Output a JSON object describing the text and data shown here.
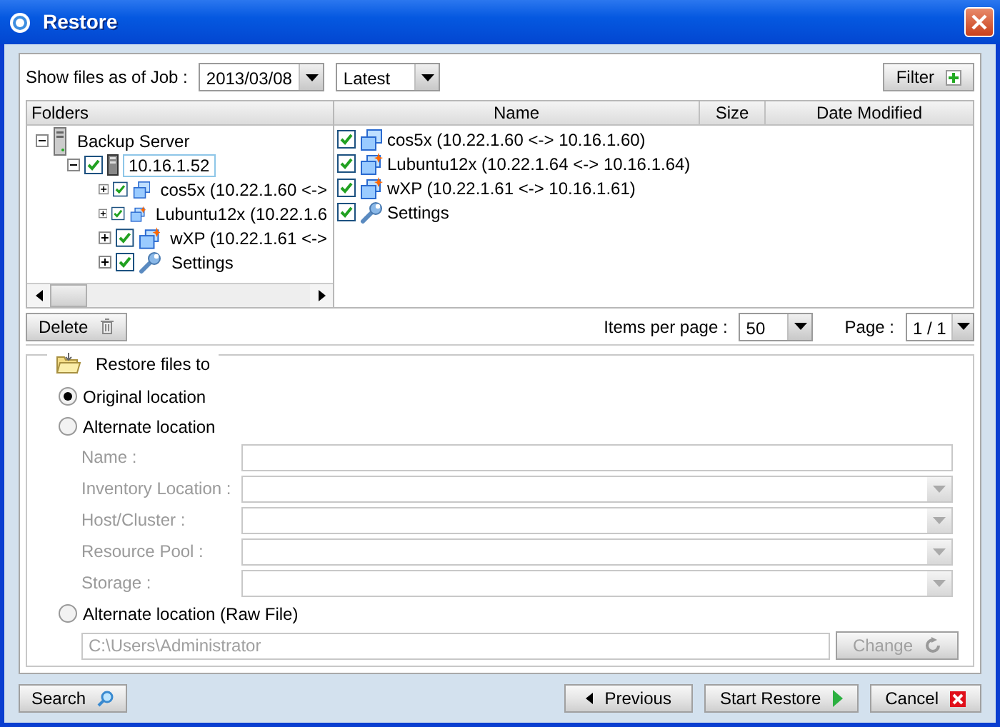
{
  "window": {
    "title": "Restore"
  },
  "job_bar": {
    "label": "Show files as of Job :",
    "date": "2013/03/08",
    "version": "Latest",
    "filter_button": "Filter"
  },
  "folders": {
    "header": "Folders",
    "tree": [
      {
        "label": "Backup Server",
        "kind": "server",
        "expanded": true,
        "selected": false,
        "children": [
          {
            "label": "10.16.1.52",
            "kind": "host",
            "checked": true,
            "expanded": true,
            "selected": true,
            "children": [
              {
                "label": "cos5x (10.22.1.60 <->",
                "kind": "vm",
                "checked": true,
                "expanded": false,
                "selected": false
              },
              {
                "label": "Lubuntu12x (10.22.1.6",
                "kind": "vm-star",
                "checked": true,
                "expanded": false,
                "selected": false
              },
              {
                "label": "wXP  (10.22.1.61 <->",
                "kind": "vm-star",
                "checked": true,
                "expanded": false,
                "selected": false
              },
              {
                "label": "Settings",
                "kind": "settings",
                "checked": true,
                "expanded": false,
                "selected": false
              }
            ]
          }
        ]
      }
    ]
  },
  "files": {
    "columns": [
      "Name",
      "Size",
      "Date Modified"
    ],
    "rows": [
      {
        "name": "cos5x (10.22.1.60 <-> 10.16.1.60)",
        "kind": "vm",
        "checked": true
      },
      {
        "name": "Lubuntu12x (10.22.1.64 <-> 10.16.1.64)",
        "kind": "vm-star",
        "checked": true
      },
      {
        "name": "wXP  (10.22.1.61 <-> 10.16.1.61)",
        "kind": "vm-star",
        "checked": true
      },
      {
        "name": "Settings",
        "kind": "settings",
        "checked": true
      }
    ]
  },
  "pager": {
    "delete_button": "Delete",
    "items_label": "Items per page :",
    "items_value": "50",
    "page_label": "Page :",
    "page_value": "1 / 1"
  },
  "restore": {
    "legend": "Restore files to",
    "options": [
      {
        "label": "Original location",
        "selected": true
      },
      {
        "label": "Alternate location",
        "selected": false,
        "fields": [
          {
            "label": "Name :",
            "kind": "text",
            "disabled": true
          },
          {
            "label": "Inventory Location :",
            "kind": "dropdown",
            "disabled": true
          },
          {
            "label": "Host/Cluster :",
            "kind": "dropdown",
            "disabled": true
          },
          {
            "label": "Resource Pool :",
            "kind": "dropdown",
            "disabled": true
          },
          {
            "label": "Storage :",
            "kind": "dropdown",
            "disabled": true
          }
        ]
      },
      {
        "label": "Alternate location (Raw File)",
        "selected": false,
        "path": {
          "value": "C:\\Users\\Administrator",
          "disabled": true
        },
        "change_button": {
          "label": "Change",
          "disabled": true
        }
      }
    ]
  },
  "footer": {
    "left": [
      {
        "label": "Search",
        "kind": "search"
      }
    ],
    "right": [
      {
        "label": "Previous",
        "kind": "previous"
      },
      {
        "label": "Start Restore",
        "kind": "start"
      },
      {
        "label": "Cancel",
        "kind": "cancel"
      }
    ]
  }
}
